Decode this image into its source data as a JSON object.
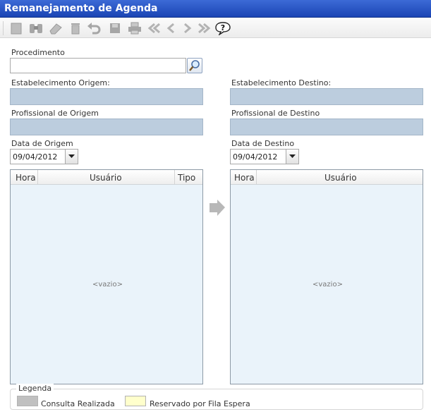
{
  "window": {
    "title": "Remanejamento de Agenda"
  },
  "toolbar": {
    "buttons": [
      {
        "icon": "new-doc-icon"
      },
      {
        "icon": "binoculars-icon"
      },
      {
        "icon": "eraser-icon"
      },
      {
        "icon": "trash-icon"
      },
      {
        "icon": "undo-icon"
      },
      {
        "icon": "save-icon"
      },
      {
        "icon": "printer-icon"
      },
      {
        "icon": "first-icon"
      },
      {
        "icon": "previous-icon"
      },
      {
        "icon": "next-icon"
      },
      {
        "icon": "last-icon"
      },
      {
        "icon": "help-icon"
      }
    ]
  },
  "form": {
    "procedimento_label": "Procedimento",
    "procedimento_value": "",
    "estab_origem_label": "Estabelecimento Origem:",
    "estab_destino_label": "Estabelecimento Destino:",
    "prof_origem_label": "Profissional de Origem",
    "prof_destino_label": "Profissional de Destino",
    "data_origem_label": "Data de Origem",
    "data_origem_value": "09/04/2012",
    "data_destino_label": "Data de Destino",
    "data_destino_value": "09/04/2012"
  },
  "grid_origem": {
    "columns": [
      "Hora",
      "Usuário",
      "Tipo"
    ],
    "empty_text": "<vazio>"
  },
  "grid_destino": {
    "columns": [
      "Hora",
      "Usuário"
    ],
    "empty_text": "<vazio>"
  },
  "legend": {
    "title": "Legenda",
    "items": [
      {
        "label": "Consulta Realizada",
        "color": "#c0c0c0"
      },
      {
        "label": "Reservado por Fila Espera",
        "color": "#ffffcc"
      }
    ]
  },
  "colors": {
    "title_bar": "#2a55c6",
    "readonly_field": "#bccdde",
    "grid_background": "#eaf3fa"
  }
}
